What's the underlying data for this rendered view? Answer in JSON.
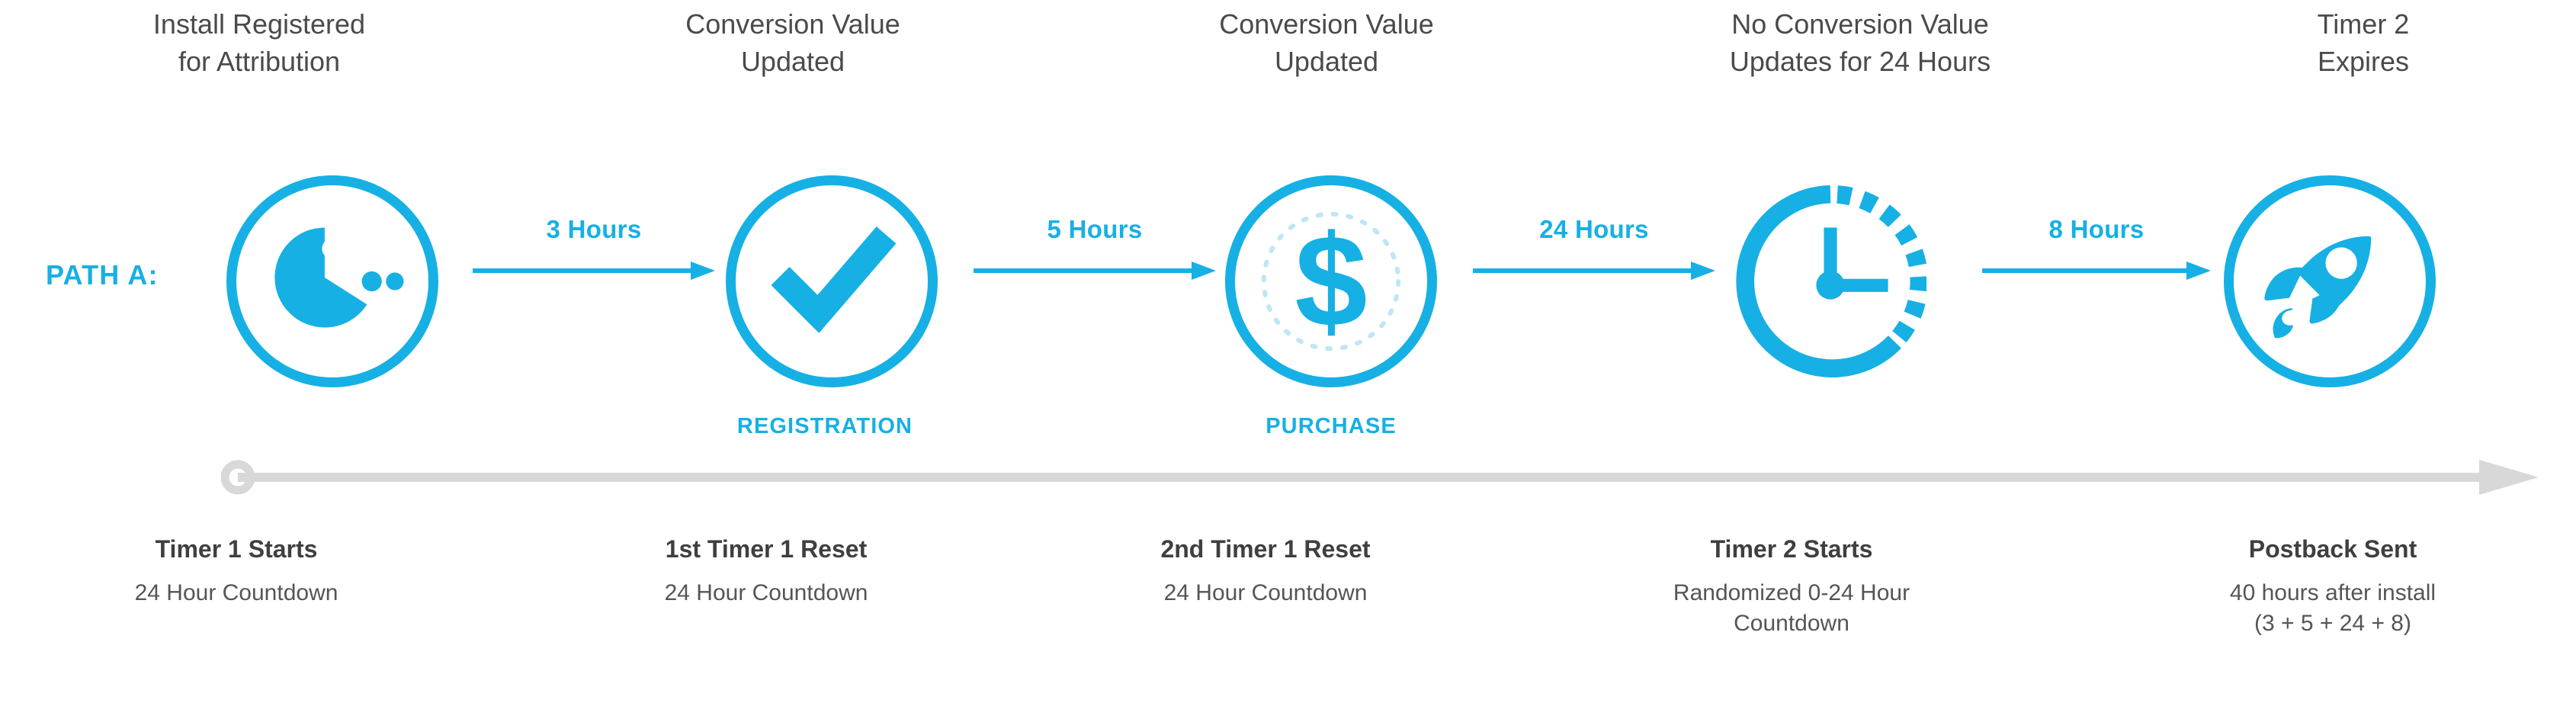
{
  "diagram": {
    "path_label": "PATH A:",
    "accent_color": "#16b0e4",
    "text_color": "#4a4a4a",
    "timeline_color": "#d8d8d8",
    "background": "#ffffff"
  },
  "steps": [
    {
      "header": "Install Registered\nfor Attribution",
      "header_line1": "Install Registered",
      "header_line2": "for Attribution",
      "icon": "pacman-install-icon",
      "event_tag": "",
      "caption_title": "Timer 1 Starts",
      "caption_sub": "24 Hour Countdown"
    },
    {
      "header": "Conversion Value\nUpdated",
      "header_line1": "Conversion Value",
      "header_line2": "Updated",
      "icon": "checkmark-icon",
      "event_tag": "REGISTRATION",
      "caption_title": "1st Timer 1 Reset",
      "caption_sub": "24 Hour Countdown"
    },
    {
      "header": "Conversion Value\nUpdated",
      "header_line1": "Conversion Value",
      "header_line2": "Updated",
      "icon": "dollar-coin-icon",
      "event_tag": "PURCHASE",
      "caption_title": "2nd Timer 1 Reset",
      "caption_sub": "24 Hour Countdown"
    },
    {
      "header": "No Conversion Value\nUpdates for 24 Hours",
      "header_line1": "No Conversion Value",
      "header_line2": "Updates for 24 Hours",
      "icon": "clock-icon",
      "event_tag": "",
      "caption_title": "Timer 2 Starts",
      "caption_sub": "Randomized 0-24 Hour\nCountdown"
    },
    {
      "header": "Timer 2\nExpires",
      "header_line1": "Timer 2",
      "header_line2": "Expires",
      "icon": "rocket-icon",
      "event_tag": "",
      "caption_title": "Postback Sent",
      "caption_sub": "40 hours after install\n(3 + 5 + 24 + 8)"
    }
  ],
  "links": [
    {
      "label": "3 Hours"
    },
    {
      "label": "5 Hours"
    },
    {
      "label": "24 Hours"
    },
    {
      "label": "8 Hours"
    }
  ],
  "captions": [
    {
      "title": "Timer 1 Starts",
      "sub_line1": "24 Hour Countdown",
      "sub_line2": ""
    },
    {
      "title": "1st Timer 1 Reset",
      "sub_line1": "24 Hour Countdown",
      "sub_line2": ""
    },
    {
      "title": "2nd Timer 1 Reset",
      "sub_line1": "24 Hour Countdown",
      "sub_line2": ""
    },
    {
      "title": "Timer 2 Starts",
      "sub_line1": "Randomized 0-24 Hour",
      "sub_line2": "Countdown"
    },
    {
      "title": "Postback Sent",
      "sub_line1": "40 hours after install",
      "sub_line2": "(3 + 5 + 24 + 8)"
    }
  ]
}
